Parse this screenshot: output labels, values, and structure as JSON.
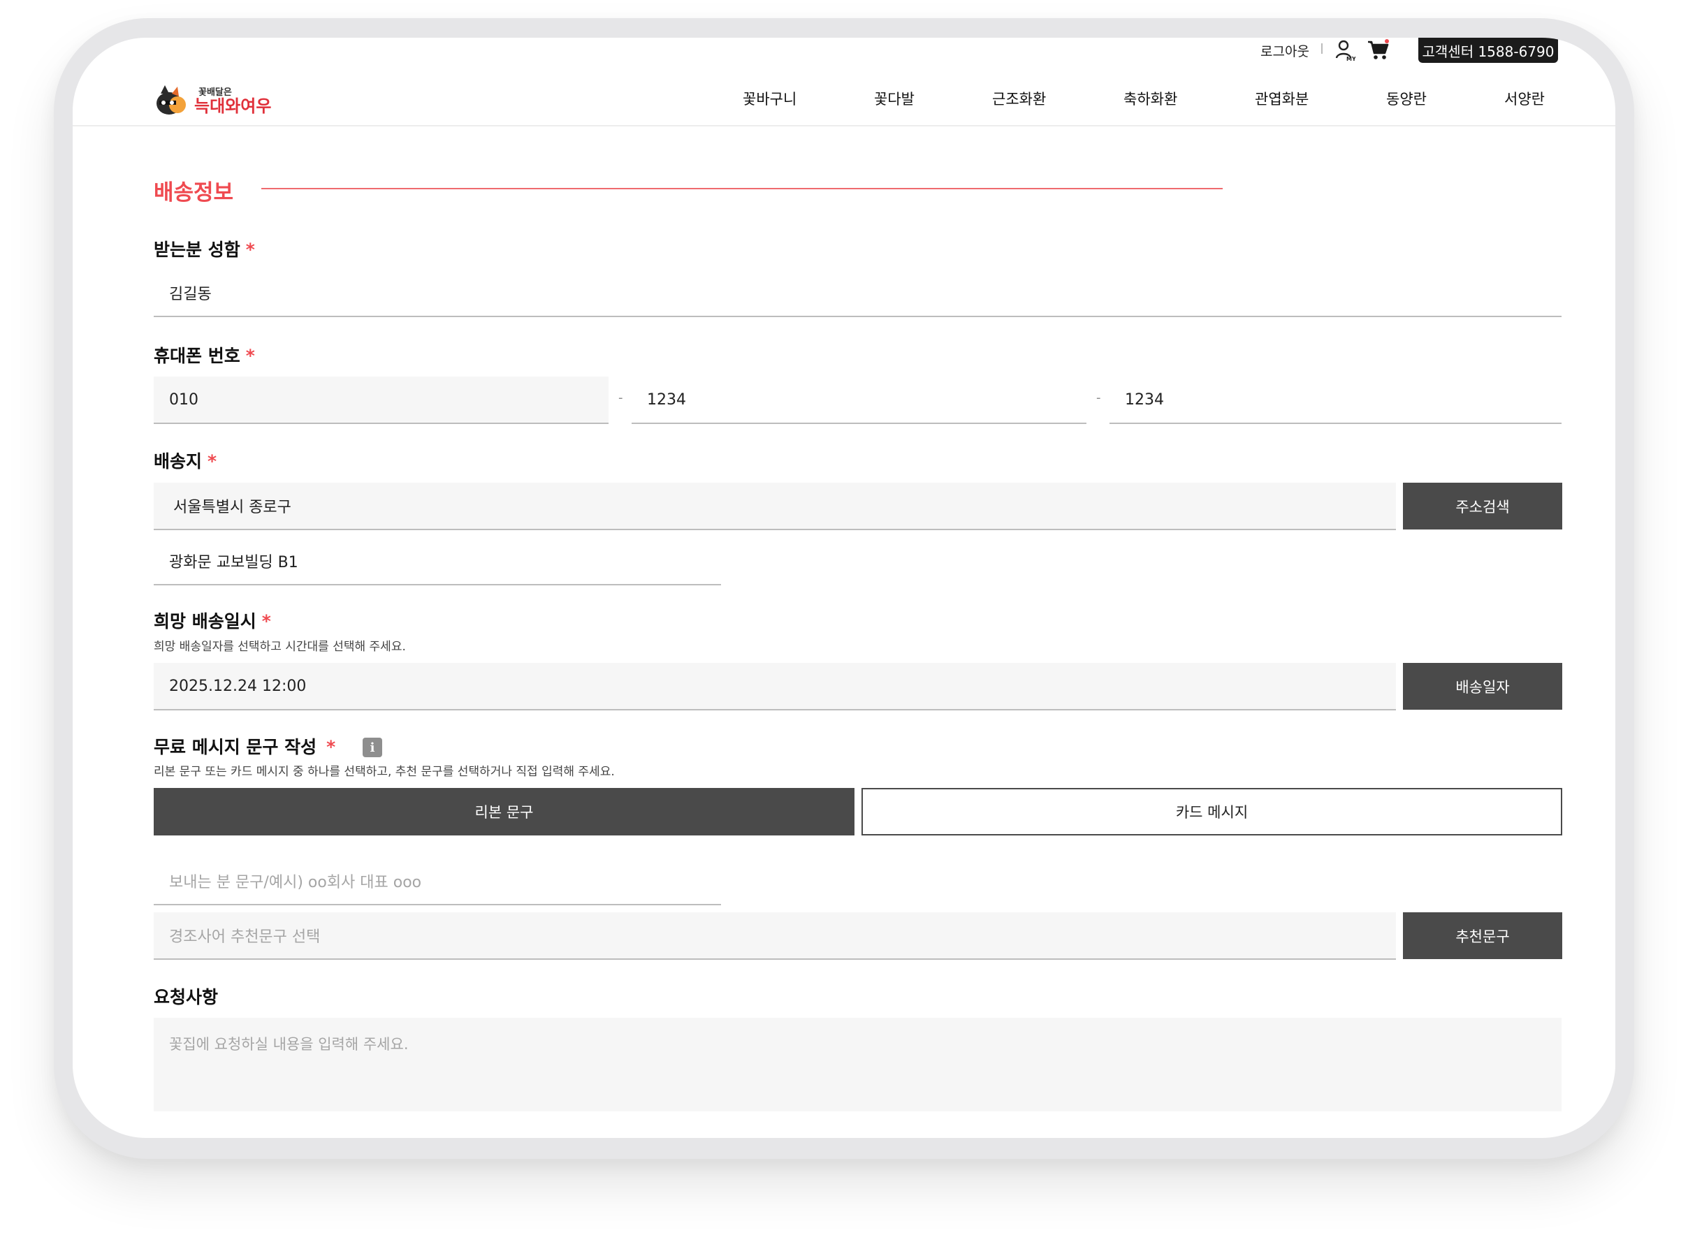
{
  "header": {
    "logout": "로그아웃",
    "my_label": "MY",
    "customer_center": "고객센터 1588-6790",
    "logo_small": "꽃배달은",
    "logo_main": "늑대와여우",
    "nav": [
      "꽃바구니",
      "꽃다발",
      "근조화환",
      "축하화환",
      "관엽화분",
      "동양란",
      "서양란"
    ]
  },
  "form": {
    "section_title": "배송정보",
    "recipient": {
      "label": "받는분 성함",
      "required": "*",
      "value": "김길동"
    },
    "phone": {
      "label": "휴대폰 번호",
      "required": "*",
      "part1": "010",
      "part2": "1234",
      "part3": "1234",
      "separator": "-"
    },
    "address": {
      "label": "배송지",
      "required": "*",
      "line1": "서울특별시 종로구",
      "line2": "광화문 교보빌딩 B1",
      "search_button": "주소검색"
    },
    "delivery_date": {
      "label": "희망 배송일시",
      "required": "*",
      "hint": "희망 배송일자를 선택하고 시간대를 선택해 주세요.",
      "value": "2025.12.24 12:00",
      "button": "배송일자"
    },
    "message": {
      "label": "무료 메시지 문구 작성",
      "required": "*",
      "info": "i",
      "hint": "리본 문구 또는 카드 메시지 중 하나를 선택하고, 추천 문구를 선택하거나 직접 입력해 주세요.",
      "tab_ribbon": "리본 문구",
      "tab_card": "카드 메시지",
      "sender_placeholder": "보내는 분 문구/예시) oo회사 대표 ooo",
      "recommend_placeholder": "경조사어 추천문구 선택",
      "recommend_button": "추천문구"
    },
    "request": {
      "label": "요청사항",
      "placeholder": "꽃집에 요청하실 내용을 입력해 주세요."
    }
  },
  "colors": {
    "accent": "#ef4a50",
    "button_dark": "#4a4a4a",
    "field_bg": "#f6f6f6"
  }
}
